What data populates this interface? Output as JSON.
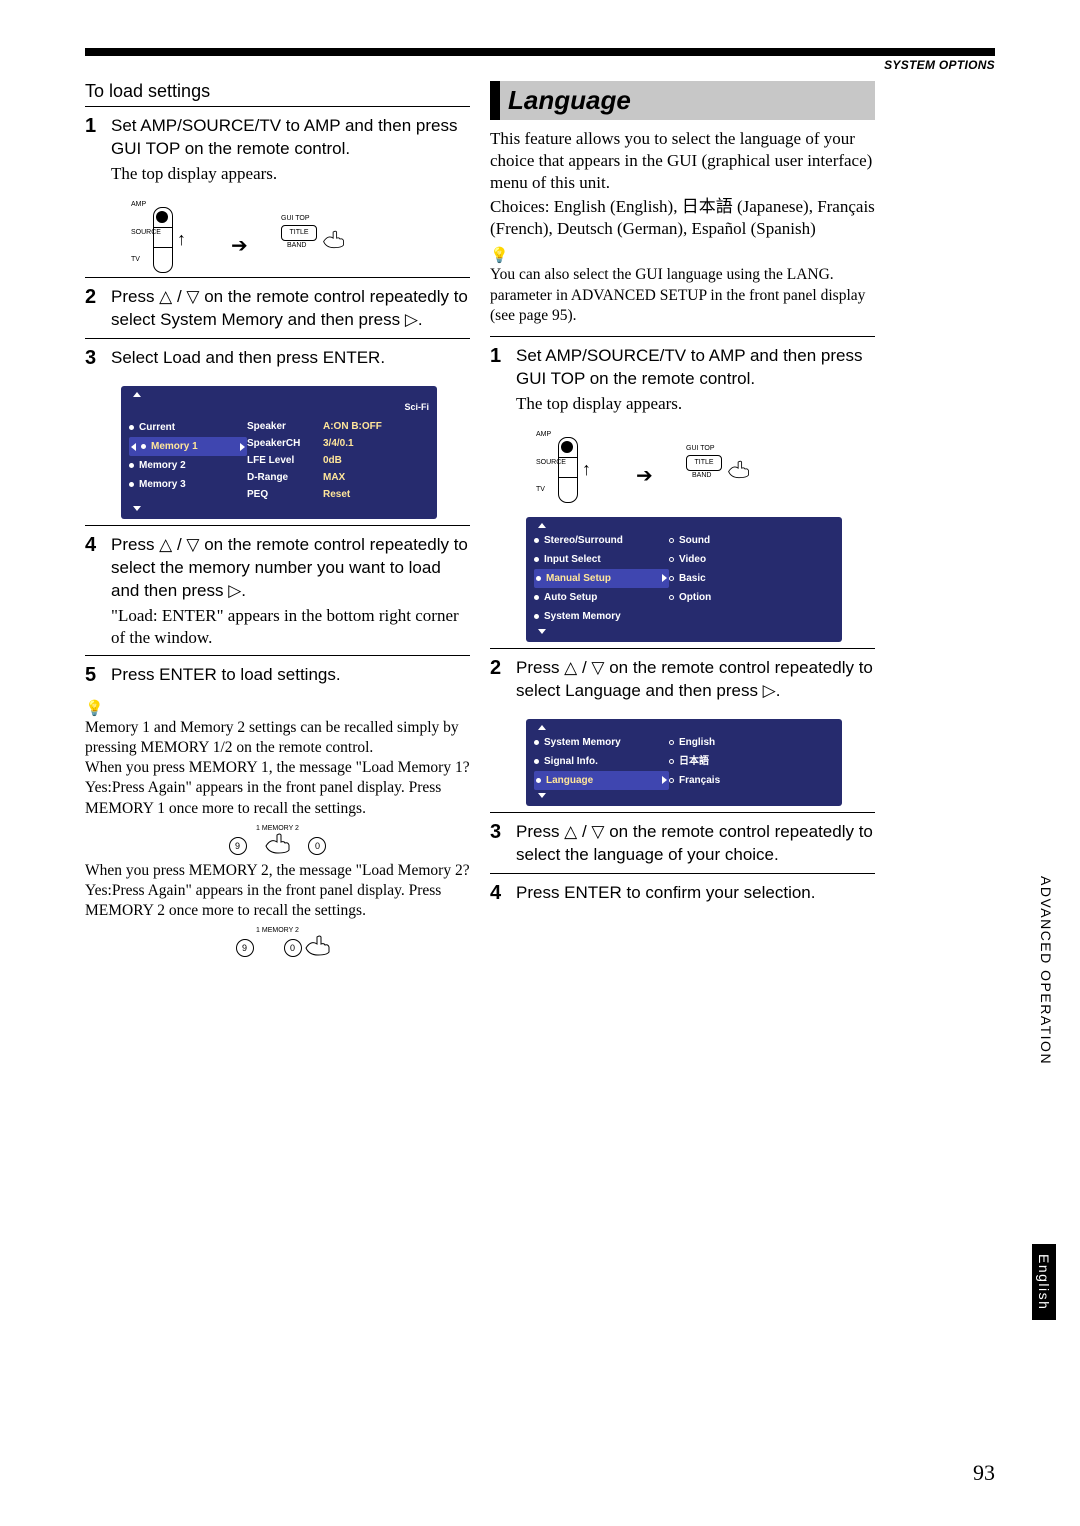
{
  "header": {
    "badge": "SYSTEM OPTIONS"
  },
  "page_number": "93",
  "side_tabs": {
    "advanced": "ADVANCED OPERATION",
    "english": "English"
  },
  "left": {
    "subhead": "To load settings",
    "steps": {
      "1": {
        "num": "1",
        "body": "Set AMP/SOURCE/TV to  AMP and then press GUI TOP on the remote control.",
        "note": "The top display appears."
      },
      "2": {
        "num": "2",
        "body": "Press  △ / ▽  on the remote control repeatedly to select System Memory and then press      ▷."
      },
      "3": {
        "num": "3",
        "body": "Select Load and then press ENTER."
      },
      "4": {
        "num": "4",
        "body": "Press  △ / ▽  on the remote control repeatedly to select the memory number you want to load and then press    ▷.",
        "note": "\"Load: ENTER\" appears in the bottom right corner of the window."
      },
      "5": {
        "num": "5",
        "body": "Press ENTER to load settings."
      }
    },
    "tip1": "Memory 1 and Memory 2 settings can be recalled simply by pressing MEMORY 1/2 on the remote control.",
    "tip2": "When you press MEMORY 1, the message \"Load Memory 1? Yes:Press Again\" appears in the front panel display. Press MEMORY 1 once more to recall the settings.",
    "tip3": "When you press MEMORY 2, the message \"Load Memory 2? Yes:Press Again\" appears in the front panel display. Press MEMORY 2 once more to recall the settings.",
    "remote": {
      "amp": "AMP",
      "source": "SOURCE",
      "tv": "TV",
      "guitop": "GUI TOP",
      "title": "TITLE",
      "band": "BAND"
    },
    "menu1": {
      "title": "Sci-Fi",
      "leftItems": [
        "Current",
        "Memory 1",
        "Memory 2",
        "Memory 3"
      ],
      "selectedIndex": 1,
      "params": [
        {
          "k": "Speaker",
          "v": "A:ON B:OFF"
        },
        {
          "k": "SpeakerCH",
          "v": "3/4/0.1"
        },
        {
          "k": "LFE Level",
          "v": "0dB"
        },
        {
          "k": "D-Range",
          "v": "MAX"
        },
        {
          "k": "PEQ",
          "v": "Reset"
        }
      ]
    },
    "memlabels": {
      "top": "1   MEMORY   2",
      "n9": "9",
      "n0": "0"
    }
  },
  "right": {
    "section_title": "Language",
    "intro1": "This feature allows you to select the language of your choice that appears in the GUI (graphical user interface) menu of this unit.",
    "intro2": "Choices: English (English), 日本語 (Japanese), Français (French), Deutsch (German), Español (Spanish)",
    "tip": "You can also select the GUI language using the LANG. parameter in ADVANCED SETUP in the front panel display (see page 95).",
    "steps": {
      "1": {
        "num": "1",
        "body": "Set AMP/SOURCE/TV to AMP and then press GUI TOP on the remote control.",
        "note": "The top display appears."
      },
      "2": {
        "num": "2",
        "body": "Press  △ / ▽  on the remote control repeatedly to select Language and then press      ▷."
      },
      "3": {
        "num": "3",
        "body": "Press  △ / ▽  on the remote control repeatedly to select the language of your choice."
      },
      "4": {
        "num": "4",
        "body": "Press ENTER to confirm your selection."
      }
    },
    "remote": {
      "amp": "AMP",
      "source": "SOURCE",
      "tv": "TV",
      "guitop": "GUI TOP",
      "title": "TITLE",
      "band": "BAND"
    },
    "menuA": {
      "left": [
        "Stereo/Surround",
        "Input Select",
        "Manual Setup",
        "Auto Setup",
        "System Memory"
      ],
      "selectedIndex": 2,
      "right": [
        "Sound",
        "Video",
        "Basic",
        "Option"
      ]
    },
    "menuB": {
      "left": [
        "System Memory",
        "Signal Info.",
        "Language"
      ],
      "selectedIndex": 2,
      "right": [
        "English",
        "日本語",
        "Français"
      ]
    }
  }
}
